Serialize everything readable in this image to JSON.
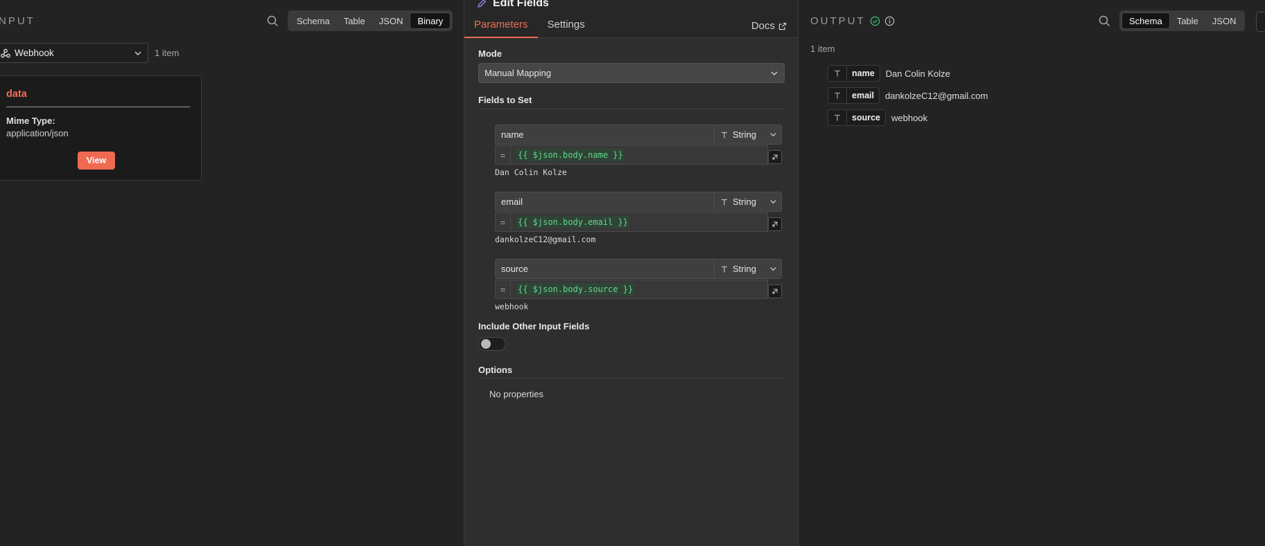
{
  "input": {
    "title": "NPUT",
    "views": [
      {
        "label": "Schema",
        "active": false
      },
      {
        "label": "Table",
        "active": false
      },
      {
        "label": "JSON",
        "active": false
      },
      {
        "label": "Binary",
        "active": true
      }
    ],
    "node_select": "Webhook",
    "item_count": "1 item",
    "binary": {
      "title": "data",
      "mime_label": "Mime Type:",
      "mime_value": "application/json",
      "view_label": "View"
    }
  },
  "center": {
    "title": "Edit Fields",
    "tabs": [
      "Parameters",
      "Settings"
    ],
    "docs_label": "Docs",
    "mode_label": "Mode",
    "mode_value": "Manual Mapping",
    "fields_label": "Fields to Set",
    "fields": [
      {
        "name": "name",
        "type": "String",
        "expr": "{{ $json.body.name }}",
        "result": "Dan Colin Kolze"
      },
      {
        "name": "email",
        "type": "String",
        "expr": "{{ $json.body.email }}",
        "result": "dankolzeC12@gmail.com"
      },
      {
        "name": "source",
        "type": "String",
        "expr": "{{ $json.body.source }}",
        "result": "webhook"
      }
    ],
    "include_label": "Include Other Input Fields",
    "include_enabled": false,
    "options_label": "Options",
    "no_props": "No properties"
  },
  "output": {
    "title": "OUTPUT",
    "views": [
      {
        "label": "Schema",
        "active": true
      },
      {
        "label": "Table",
        "active": false
      },
      {
        "label": "JSON",
        "active": false
      }
    ],
    "item_count": "1 item",
    "schema": [
      {
        "key": "name",
        "value": "Dan Colin Kolze"
      },
      {
        "key": "email",
        "value": "dankolzeC12@gmail.com"
      },
      {
        "key": "source",
        "value": "webhook"
      }
    ]
  },
  "colors": {
    "accent": "#ee6e57",
    "success": "#3dbb6e",
    "expression": "#64d68f"
  },
  "icons": [
    "search-icon",
    "webhook-icon",
    "chevron-down-icon",
    "pencil-icon",
    "external-link-icon",
    "type-t-icon",
    "expand-icon",
    "check-circle-icon",
    "info-icon"
  ]
}
